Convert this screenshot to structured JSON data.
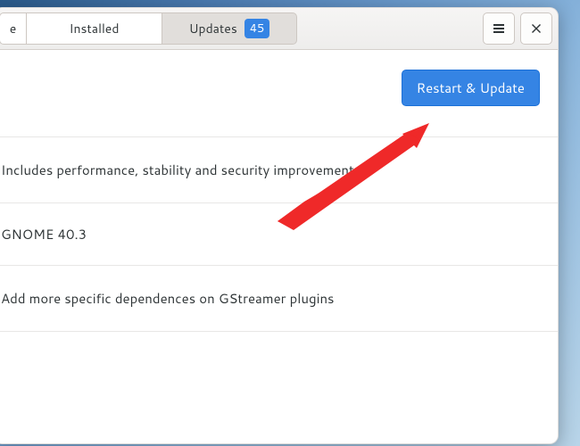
{
  "tabs": {
    "explore_partial": "e",
    "installed": "Installed",
    "updates": "Updates",
    "updates_count": "45"
  },
  "actions": {
    "restart_update": "Restart & Update"
  },
  "updates": {
    "item0": "Includes performance, stability and security improvements.",
    "item1": "GNOME 40.3",
    "item2": "Add more specific dependences on GStreamer plugins"
  },
  "colors": {
    "accent": "#3584e4",
    "arrow": "#ef2929"
  }
}
